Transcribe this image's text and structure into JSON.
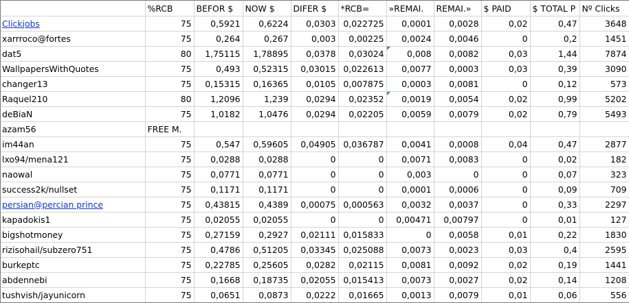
{
  "headers": [
    "",
    "%RCB",
    "BEFOR $",
    "NOW $",
    "DIFER $",
    "*RCB=",
    "»REMAI.",
    "REMAI.»",
    "$ PAID",
    "$ TOTAL P",
    "Nº Clicks"
  ],
  "rows": [
    {
      "name": "Clickjobs",
      "link": true,
      "cells": [
        "75",
        "0,5921",
        "0,6224",
        "0,0303",
        "0,022725",
        "0,0001",
        "0,0028",
        "0,02",
        "0,47",
        "3648"
      ]
    },
    {
      "name": "xarrroco@fortes",
      "cells": [
        "75",
        "0,264",
        "0,267",
        "0,003",
        "0,00225",
        "0,0024",
        "0,0046",
        "0",
        "0,2",
        "1451"
      ]
    },
    {
      "name": "dat5",
      "flag_col": 5,
      "cells": [
        "80",
        "1,75115",
        "1,78895",
        "0,0378",
        "0,03024",
        "0,008",
        "0,0082",
        "0,03",
        "1,44",
        "7874"
      ]
    },
    {
      "name": "WallpapersWithQuotes",
      "cells": [
        "75",
        "0,493",
        "0,52315",
        "0,03015",
        "0,022613",
        "0,0077",
        "0,0003",
        "0,03",
        "0,39",
        "3090"
      ]
    },
    {
      "name": "changer13",
      "cells": [
        "75",
        "0,15315",
        "0,16365",
        "0,0105",
        "0,007875",
        "0,0003",
        "0,0081",
        "0",
        "0,12",
        "573"
      ]
    },
    {
      "name": "Raquel210",
      "flag_col": 5,
      "cells": [
        "80",
        "1,2096",
        "1,239",
        "0,0294",
        "0,02352",
        "0,0019",
        "0,0054",
        "0,02",
        "0,99",
        "5202"
      ]
    },
    {
      "name": "deBiaN",
      "cells": [
        "75",
        "1,0182",
        "1,0476",
        "0,0294",
        "0,02205",
        "0,0059",
        "0,0079",
        "0,02",
        "0,79",
        "5493"
      ]
    },
    {
      "name": "azam56",
      "note": "FREE M.",
      "cells": [
        "",
        "",
        "",
        "",
        "",
        "",
        "",
        "",
        "",
        ""
      ]
    },
    {
      "name": "im44an",
      "cells": [
        "75",
        "0,547",
        "0,59605",
        "0,04905",
        "0,036787",
        "0,0041",
        "0,0008",
        "0,04",
        "0,47",
        "2877"
      ]
    },
    {
      "name": "lxo94/mena121",
      "cells": [
        "75",
        "0,0288",
        "0,0288",
        "0",
        "0",
        "0,0071",
        "0,0083",
        "0",
        "0,02",
        "182"
      ]
    },
    {
      "name": "naowal",
      "cells": [
        "75",
        "0,0771",
        "0,0771",
        "0",
        "0",
        "0,003",
        "0",
        "0",
        "0,07",
        "323"
      ]
    },
    {
      "name": "success2k/nullset",
      "cells": [
        "75",
        "0,1171",
        "0,1171",
        "0",
        "0",
        "0,0001",
        "0,0006",
        "0",
        "0,09",
        "709"
      ]
    },
    {
      "name": "persian@percian prince",
      "link": true,
      "cells": [
        "75",
        "0,43815",
        "0,4389",
        "0,00075",
        "0,000563",
        "0,0032",
        "0,0037",
        "0",
        "0,33",
        "2297"
      ]
    },
    {
      "name": "kapadokis1",
      "cells": [
        "75",
        "0,02055",
        "0,02055",
        "0",
        "0",
        "0,00471",
        "0,00797",
        "0",
        "0,01",
        "127"
      ]
    },
    {
      "name": "bigshotmoney",
      "cells": [
        "75",
        "0,27159",
        "0,2927",
        "0,02111",
        "0,015833",
        "0",
        "0,0058",
        "0,01",
        "0,22",
        "1830"
      ]
    },
    {
      "name": "rizisohail/subzero751",
      "cells": [
        "75",
        "0,4786",
        "0,51205",
        "0,03345",
        "0,025088",
        "0,0073",
        "0,0023",
        "0,03",
        "0,4",
        "2595"
      ]
    },
    {
      "name": "burkeptc",
      "cells": [
        "75",
        "0,22785",
        "0,25605",
        "0,0282",
        "0,02115",
        "0,0081",
        "0,0092",
        "0,02",
        "0,19",
        "1441"
      ]
    },
    {
      "name": "abdennebi",
      "cells": [
        "75",
        "0,1668",
        "0,18735",
        "0,02055",
        "0,015413",
        "0,0073",
        "0,0027",
        "0,02",
        "0,14",
        "1208"
      ]
    },
    {
      "name": "tushvish/jayunicorn",
      "cells": [
        "75",
        "0,0651",
        "0,0873",
        "0,0222",
        "0,01665",
        "0,0013",
        "0,0079",
        "0,01",
        "0,06",
        "556"
      ]
    }
  ],
  "colors": {
    "link": "#0f35d8",
    "grid": "#d4d4d4",
    "comment_flag": "#2f9a3a"
  }
}
